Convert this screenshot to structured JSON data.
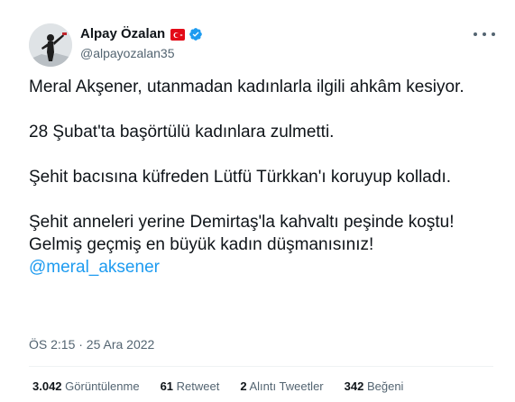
{
  "author": {
    "name": "Alpay Özalan",
    "handle": "@alpayozalan35"
  },
  "tweet": {
    "paragraphs": [
      "Meral Akşener, utanmadan kadınlarla ilgili ahkâm kesiyor.",
      "28 Şubat'ta başörtülü kadınlara zulmetti.",
      "Şehit bacısına küfreden Lütfü Türkkan'ı koruyup kolladı.",
      "Şehit anneleri yerine Demirtaş'la kahvaltı peşinde koştu! Gelmiş geçmiş en büyük kadın düşmanısınız!"
    ],
    "mention": "@meral_aksener",
    "timestamp": "ÖS 2:15 · 25 Ara 2022"
  },
  "stats": {
    "views_count": "3.042",
    "views_label": "Görüntülenme",
    "retweets_count": "61",
    "retweets_label": "Retweet",
    "quotes_count": "2",
    "quotes_label": "Alıntı Tweetler",
    "likes_count": "342",
    "likes_label": "Beğeni"
  },
  "colors": {
    "accent": "#1d9bf0",
    "secondary_text": "#536471",
    "flag_red": "#e30a17"
  },
  "icons": [
    "avatar",
    "turkish-flag-icon",
    "verified-badge-icon",
    "more-options-icon"
  ]
}
